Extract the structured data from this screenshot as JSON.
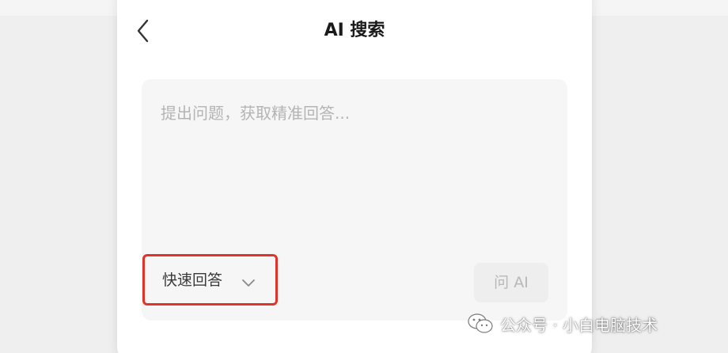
{
  "header": {
    "title": "AI 搜索",
    "back_icon": "chevron-left-icon"
  },
  "query": {
    "placeholder": "提出问题，获取精准回答...",
    "value": ""
  },
  "mode": {
    "label": "快速回答",
    "icon": "chevron-down-icon",
    "highlight_color": "#e0342a"
  },
  "ask_button": {
    "label": "问 AI"
  },
  "watermark": {
    "text": "公众号 · 小白电脑技术",
    "icon": "wechat-icon"
  }
}
